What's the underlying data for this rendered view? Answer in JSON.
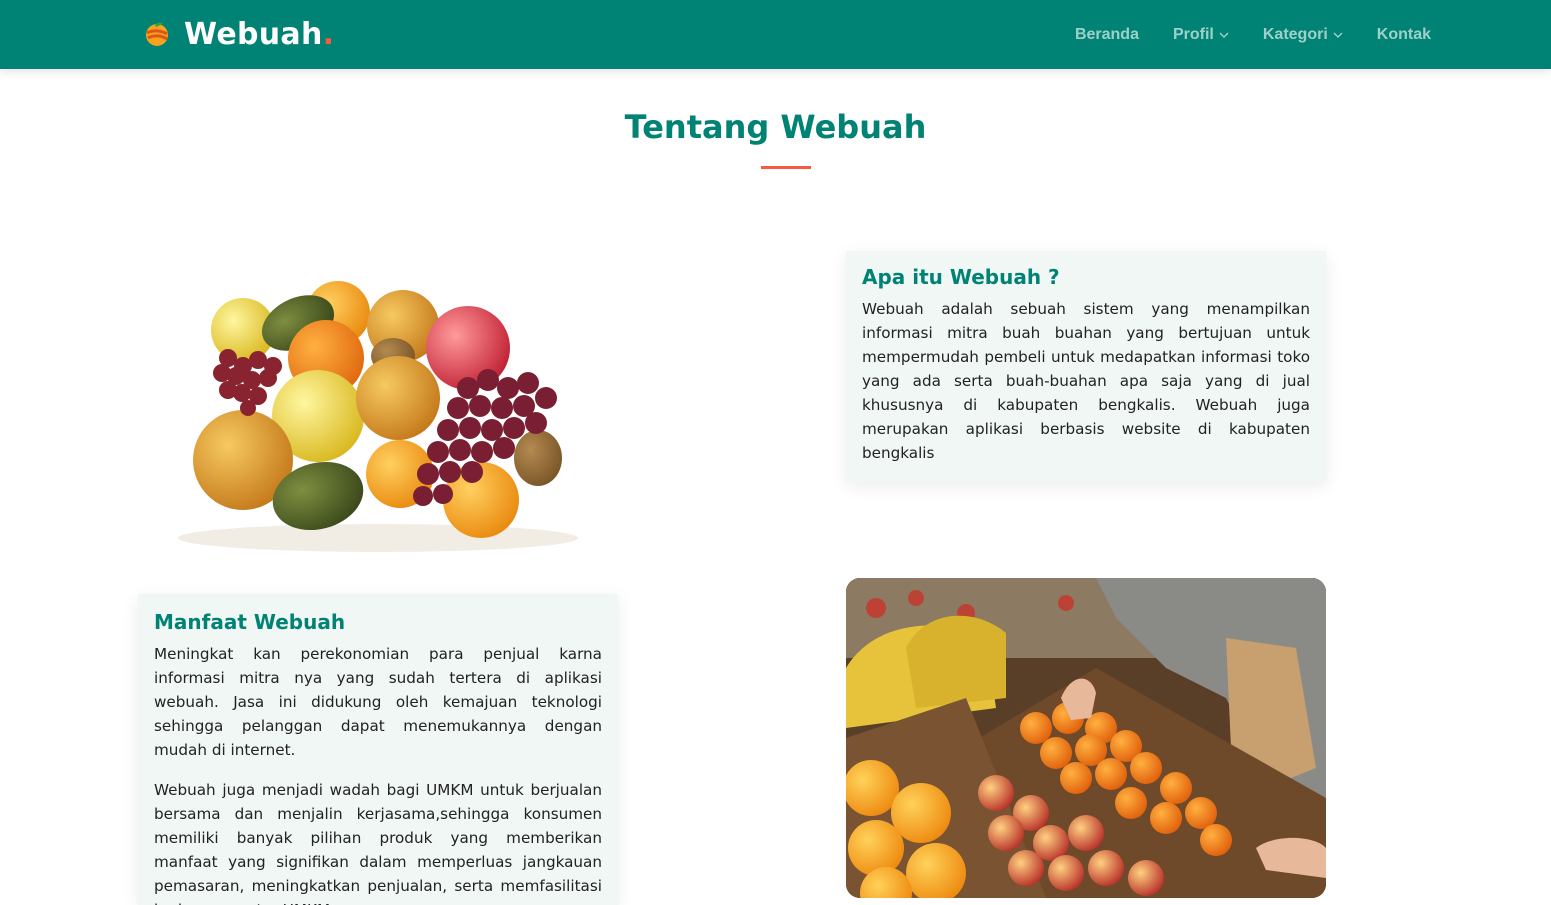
{
  "header": {
    "brand": "Webuah",
    "brand_dot": ".",
    "nav": [
      {
        "label": "Beranda",
        "dropdown": false
      },
      {
        "label": "Profil",
        "dropdown": true
      },
      {
        "label": "Kategori",
        "dropdown": true
      },
      {
        "label": "Kontak",
        "dropdown": false
      }
    ]
  },
  "section": {
    "title": "Tentang Webuah"
  },
  "about_card": {
    "heading": "Apa itu Webuah ?",
    "text": "Webuah adalah sebuah sistem yang menampilkan informasi mitra buah buahan yang bertujuan untuk mempermudah pembeli untuk medapatkan informasi toko yang ada serta buah-buahan apa saja yang di jual khususnya di kabupaten bengkalis. Webuah juga merupakan aplikasi berbasis website di kabupaten bengkalis"
  },
  "benefit_card": {
    "heading": "Manfaat Webuah",
    "paragraph_1": "Meningkat kan perekonomian para penjual karna informasi mitra nya yang sudah tertera di aplikasi webuah. Jasa ini didukung oleh kemajuan teknologi sehingga pelanggan dapat menemukannya dengan mudah di internet.",
    "paragraph_2": "Webuah juga menjadi wadah bagi UMKM untuk berjualan bersama dan menjalin kerjasama,sehingga konsumen memiliki banyak pilihan produk yang memberikan manfaat yang signifikan dalam memperluas jangkauan pemasaran, meningkatkan penjualan, serta memfasilitasi kerjasama antar UMKM."
  },
  "images": {
    "left": "fruit-pile-image",
    "right": "fruit-market-image"
  },
  "colors": {
    "primary": "#008374",
    "accent": "#f85a40",
    "card_bg": "#f0f7f4"
  }
}
